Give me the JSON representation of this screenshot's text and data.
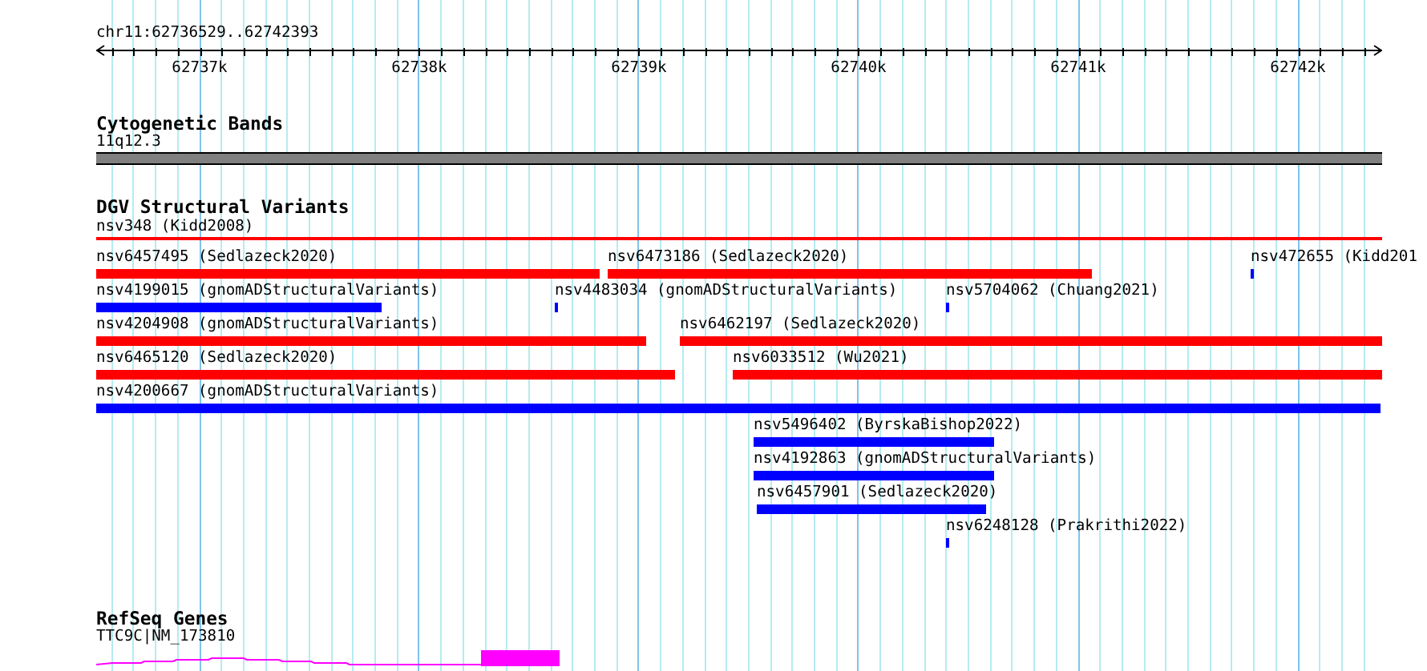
{
  "ruler": {
    "location": "chr11:62736529..62742393",
    "ticks": [
      {
        "label": "62737k"
      },
      {
        "label": "62738k"
      },
      {
        "label": "62739k"
      },
      {
        "label": "62740k"
      },
      {
        "label": "62741k"
      },
      {
        "label": "62742k"
      }
    ]
  },
  "cytobands": {
    "title": "Cytogenetic Bands",
    "band": "11q12.3"
  },
  "dgv": {
    "title": "DGV Structural Variants",
    "lanes": [
      [
        {
          "label": "nsv348 (Kidd2008)",
          "color": "#ff0000"
        }
      ],
      [
        {
          "label": "nsv6457495 (Sedlazeck2020)",
          "color": "#ff0000"
        },
        {
          "label": "nsv6473186 (Sedlazeck2020)",
          "color": "#ff0000"
        },
        {
          "label": "nsv472655 (Kidd201",
          "color": "#0000ff"
        }
      ],
      [
        {
          "label": "nsv4199015 (gnomADStructuralVariants)",
          "color": "#0000ff"
        },
        {
          "label": "nsv4483034 (gnomADStructuralVariants)",
          "color": "#0000ff"
        },
        {
          "label": "nsv5704062 (Chuang2021)",
          "color": "#0000ff"
        }
      ],
      [
        {
          "label": "nsv4204908 (gnomADStructuralVariants)",
          "color": "#ff0000"
        },
        {
          "label": "nsv6462197 (Sedlazeck2020)",
          "color": "#ff0000"
        }
      ],
      [
        {
          "label": "nsv6465120 (Sedlazeck2020)",
          "color": "#ff0000"
        },
        {
          "label": "nsv6033512 (Wu2021)",
          "color": "#ff0000"
        }
      ],
      [
        {
          "label": "nsv4200667 (gnomADStructuralVariants)",
          "color": "#0000ff"
        }
      ],
      [
        {
          "label": "nsv5496402 (ByrskaBishop2022)",
          "color": "#0000ff"
        }
      ],
      [
        {
          "label": "nsv4192863 (gnomADStructuralVariants)",
          "color": "#0000ff"
        }
      ],
      [
        {
          "label": "nsv6457901 (Sedlazeck2020)",
          "color": "#0000ff"
        }
      ],
      [
        {
          "label": "nsv6248128 (Prakrithi2022)",
          "color": "#0000ff"
        }
      ]
    ]
  },
  "refseq": {
    "title": "RefSeq Genes",
    "gene": {
      "label": "TTC9C|NM_173810"
    }
  }
}
